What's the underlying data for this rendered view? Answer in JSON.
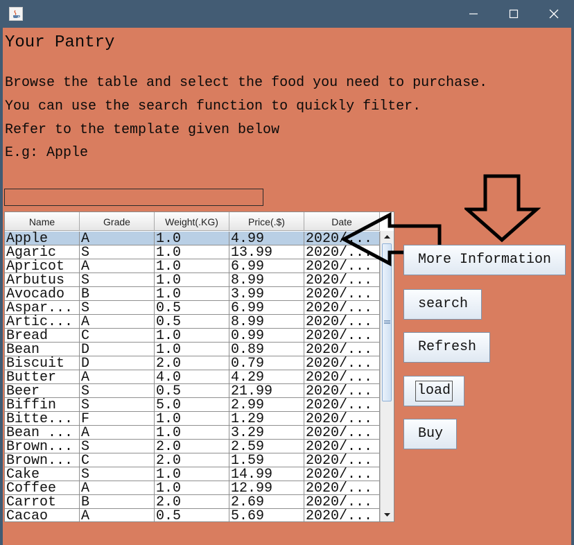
{
  "window": {
    "minimize_glyph": "–",
    "maximize_glyph": "□",
    "close_glyph": "✕"
  },
  "header": {
    "title": "Your Pantry",
    "lines": [
      "Browse the table and select the food you need to purchase.",
      "You can use the search function to quickly filter.",
      "Refer to the template given below",
      "E.g: Apple"
    ]
  },
  "search": {
    "value": ""
  },
  "table": {
    "columns": [
      "Name",
      "Grade",
      "Weight(.KG)",
      "Price(.$)",
      "Date"
    ],
    "selected_row": 0,
    "rows": [
      [
        "Apple",
        "A",
        "1.0",
        "4.99",
        "2020/..."
      ],
      [
        "Agaric",
        "S",
        "1.0",
        "13.99",
        "2020/..."
      ],
      [
        "Apricot",
        "A",
        "1.0",
        "6.99",
        "2020/..."
      ],
      [
        "Arbutus",
        "S",
        "1.0",
        "8.99",
        "2020/..."
      ],
      [
        "Avocado",
        "B",
        "1.0",
        "3.99",
        "2020/..."
      ],
      [
        "Aspar...",
        "S",
        "0.5",
        "6.99",
        "2020/..."
      ],
      [
        "Artic...",
        "A",
        "0.5",
        "8.99",
        "2020/..."
      ],
      [
        "Bread",
        "C",
        "1.0",
        "0.99",
        "2020/..."
      ],
      [
        "Bean",
        "D",
        "1.0",
        "0.89",
        "2020/..."
      ],
      [
        "Biscuit",
        "D",
        "2.0",
        "0.79",
        "2020/..."
      ],
      [
        "Butter",
        "A",
        "4.0",
        "4.29",
        "2020/..."
      ],
      [
        "Beer",
        "S",
        "0.5",
        "21.99",
        "2020/..."
      ],
      [
        "Biffin",
        "S",
        "5.0",
        "2.99",
        "2020/..."
      ],
      [
        "Bitte...",
        "F",
        "1.0",
        "1.29",
        "2020/..."
      ],
      [
        "Bean ...",
        "A",
        "1.0",
        "3.29",
        "2020/..."
      ],
      [
        "Brown...",
        "S",
        "2.0",
        "2.59",
        "2020/..."
      ],
      [
        "Brown...",
        "C",
        "2.0",
        "1.59",
        "2020/..."
      ],
      [
        "Cake",
        "S",
        "1.0",
        "14.99",
        "2020/..."
      ],
      [
        "Coffee",
        "A",
        "1.0",
        "12.99",
        "2020/..."
      ],
      [
        "Carrot",
        "B",
        "2.0",
        "2.69",
        "2020/..."
      ],
      [
        "Cacao",
        "A",
        "0.5",
        "5.69",
        "2020/..."
      ]
    ]
  },
  "buttons": {
    "more_info": "More Information",
    "search": "search",
    "refresh": "Refresh",
    "load": "load",
    "buy": "Buy"
  },
  "colors": {
    "background": "#d97d5f",
    "titlebar": "#435c74",
    "selection": "#b9cfe5"
  },
  "icons": [
    "java-app-icon",
    "arrow-left-icon",
    "arrow-down-icon",
    "scroll-up-icon",
    "scroll-down-icon"
  ]
}
